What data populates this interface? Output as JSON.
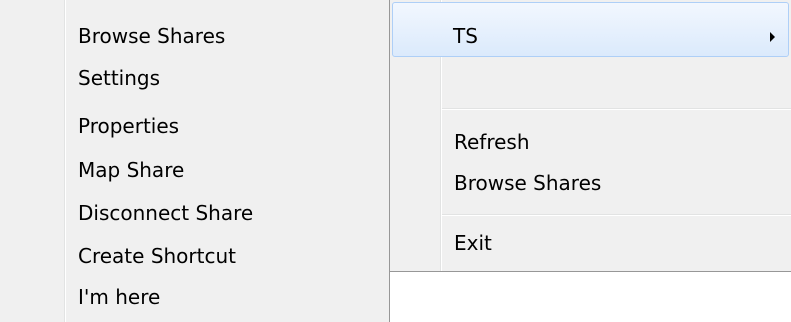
{
  "left_menu": {
    "items": [
      {
        "label": "Browse Shares"
      },
      {
        "label": "Settings"
      },
      {
        "label": "Properties"
      },
      {
        "label": "Map Share"
      },
      {
        "label": "Disconnect Share"
      },
      {
        "label": "Create Shortcut"
      },
      {
        "label": "I'm here"
      }
    ]
  },
  "right_menu": {
    "submenu": {
      "label": "TS",
      "has_submenu_arrow": true
    },
    "refresh_label": "Refresh",
    "browse_shares_label": "Browse Shares",
    "exit_label": "Exit"
  },
  "colors": {
    "menu_background": "#f0f0f0",
    "highlight_border": "#aecff7",
    "highlight_fill": "#dbeafc",
    "menu_border": "#979797"
  }
}
